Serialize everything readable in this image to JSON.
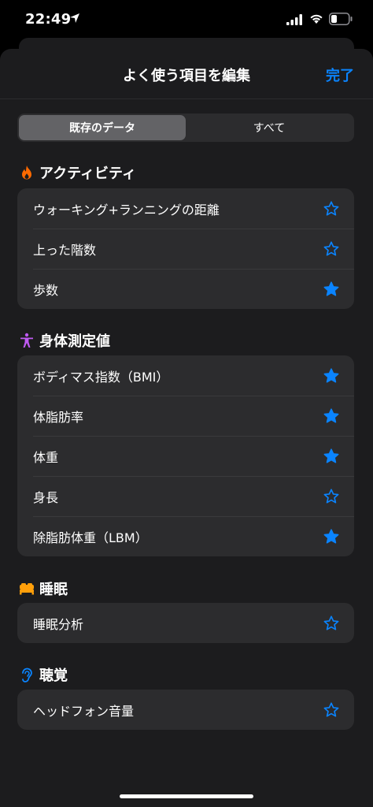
{
  "status_bar": {
    "time": "22:49"
  },
  "header": {
    "title": "よく使う項目を編集",
    "done_label": "完了"
  },
  "segments": [
    {
      "label": "既存のデータ",
      "active": true
    },
    {
      "label": "すべて",
      "active": false
    }
  ],
  "colors": {
    "accent": "#0a84ff",
    "activity": "#ff6a00",
    "body": "#bf5af2",
    "sleep": "#ff9f0a",
    "hearing": "#0a84ff"
  },
  "sections": [
    {
      "title": "アクティビティ",
      "icon": "flame-icon",
      "items": [
        {
          "label": "ウォーキング+ランニングの距離",
          "favorite": false
        },
        {
          "label": "上った階数",
          "favorite": false
        },
        {
          "label": "歩数",
          "favorite": true
        }
      ]
    },
    {
      "title": "身体測定値",
      "icon": "person-figure-icon",
      "items": [
        {
          "label": "ボディマス指数（BMI）",
          "favorite": true
        },
        {
          "label": "体脂肪率",
          "favorite": true
        },
        {
          "label": "体重",
          "favorite": true
        },
        {
          "label": "身長",
          "favorite": false
        },
        {
          "label": "除脂肪体重（LBM）",
          "favorite": true
        }
      ]
    },
    {
      "title": "睡眠",
      "icon": "bed-icon",
      "items": [
        {
          "label": "睡眠分析",
          "favorite": false
        }
      ]
    },
    {
      "title": "聴覚",
      "icon": "ear-icon",
      "items": [
        {
          "label": "ヘッドフォン音量",
          "favorite": false
        }
      ]
    }
  ]
}
